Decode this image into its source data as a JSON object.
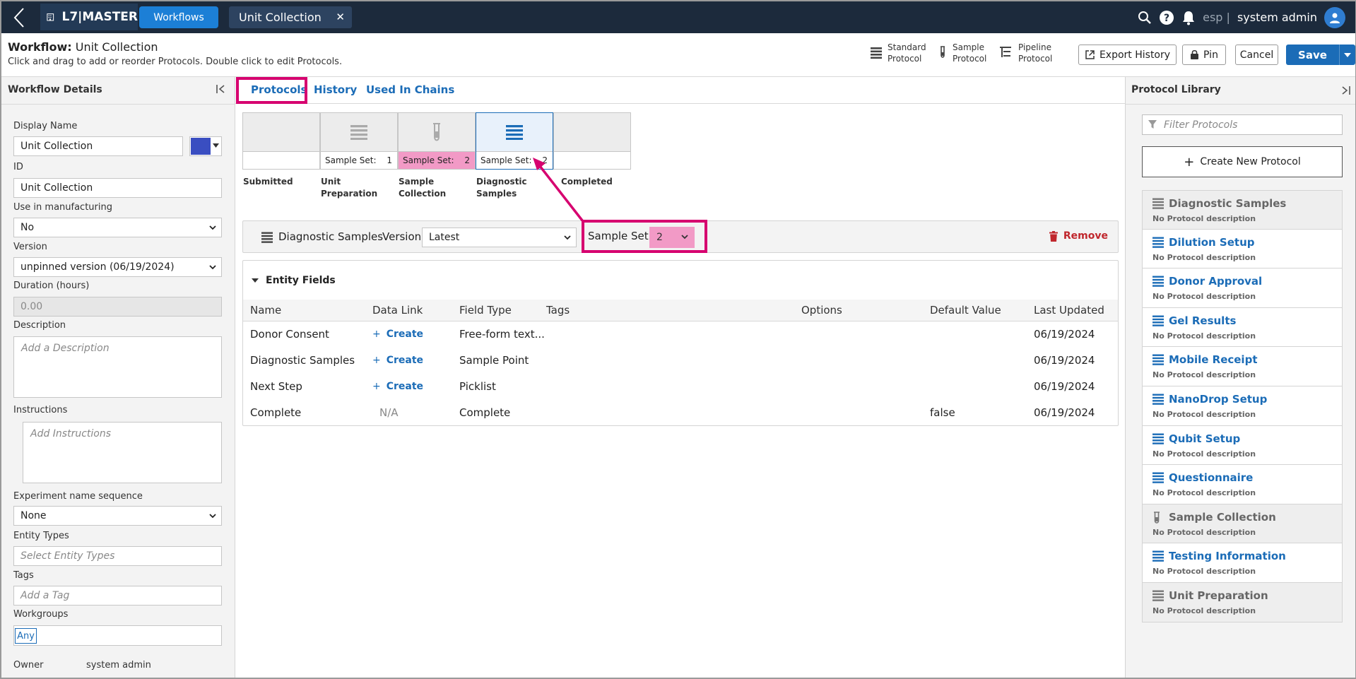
{
  "topbar": {
    "app_name": "L7|MASTER",
    "nav_button": "Workflows",
    "doc_tab": "Unit Collection",
    "lab": "esp |",
    "user": "system admin"
  },
  "header": {
    "title_prefix": "Workflow:",
    "title": "Unit Collection",
    "subtitle": "Click and drag to add or reorder Protocols. Double click to edit Protocols.",
    "legend": [
      {
        "line1": "Standard",
        "line2": "Protocol",
        "icon": "standard-protocol-icon"
      },
      {
        "line1": "Sample",
        "line2": "Protocol",
        "icon": "sample-protocol-icon"
      },
      {
        "line1": "Pipeline",
        "line2": "Protocol",
        "icon": "pipeline-protocol-icon"
      }
    ],
    "export_history": "Export History",
    "pin": "Pin",
    "cancel": "Cancel",
    "save": "Save"
  },
  "left": {
    "panel_title": "Workflow Details",
    "display_name_label": "Display Name",
    "display_name": "Unit Collection",
    "id_label": "ID",
    "id": "Unit Collection",
    "manufacturing_label": "Use in manufacturing",
    "manufacturing": "No",
    "version_label": "Version",
    "version": "unpinned version (06/19/2024)",
    "duration_label": "Duration (hours)",
    "duration": "0.00",
    "description_label": "Description",
    "description_placeholder": "Add a Description",
    "instructions_label": "Instructions",
    "instructions_placeholder": "Add Instructions",
    "exp_seq_label": "Experiment name sequence",
    "exp_seq": "None",
    "entity_types_label": "Entity Types",
    "entity_types_placeholder": "Select Entity Types",
    "tags_label": "Tags",
    "tags_placeholder": "Add a Tag",
    "workgroups_label": "Workgroups",
    "workgroup_chip": "Any",
    "owner_label": "Owner",
    "owner": "system admin",
    "accent": "#3a4ec1"
  },
  "center": {
    "tabs": [
      "Protocols",
      "History",
      "Used In Chains"
    ],
    "steps": [
      {
        "name1": "Submitted",
        "name2": "",
        "sample_label": "",
        "sample_value": "",
        "icon": "none"
      },
      {
        "name1": "Unit Preparation",
        "name2": "",
        "sample_label": "Sample Set:",
        "sample_value": "1",
        "icon": "standard-protocol-icon"
      },
      {
        "name1": "Sample",
        "name2": "Collection",
        "sample_label": "Sample Set:",
        "sample_value": "2",
        "icon": "sample-protocol-icon"
      },
      {
        "name1": "Diagnostic",
        "name2": "Samples",
        "sample_label": "Sample Set:",
        "sample_value": "2",
        "icon": "standard-protocol-icon"
      },
      {
        "name1": "Completed",
        "name2": "",
        "sample_label": "",
        "sample_value": "",
        "icon": "none"
      }
    ],
    "protocol": {
      "name": "Diagnostic Samples",
      "version_label": "Version",
      "version": "Latest",
      "sample_set_label": "Sample Set",
      "sample_set": "2",
      "remove": "Remove"
    },
    "entity_fields": {
      "title": "Entity Fields",
      "columns": [
        "Name",
        "Data Link",
        "Field Type",
        "Tags",
        "Options",
        "Default Value",
        "Last Updated"
      ],
      "create_label": "Create",
      "rows": [
        {
          "name": "Donor Consent",
          "link": "Create",
          "type": "Free-form text...",
          "tags": "",
          "options": "",
          "default": "",
          "updated": "06/19/2024"
        },
        {
          "name": "Diagnostic Samples",
          "link": "Create",
          "type": "Sample Point",
          "tags": "",
          "options": "",
          "default": "",
          "updated": "06/19/2024"
        },
        {
          "name": "Next Step",
          "link": "Create",
          "type": "Picklist",
          "tags": "",
          "options": "",
          "default": "",
          "updated": "06/19/2024"
        },
        {
          "name": "Complete",
          "link": "N/A",
          "type": "Complete",
          "tags": "",
          "options": "",
          "default": "false",
          "updated": "06/19/2024"
        }
      ]
    },
    "highlight_color": "#d6006f",
    "pink": "#f29ac6"
  },
  "right": {
    "panel_title": "Protocol Library",
    "filter_placeholder": "Filter Protocols",
    "create_new": "Create New Protocol",
    "items": [
      {
        "name": "Diagnostic Samples",
        "desc": "No Protocol description",
        "icon": "standard-protocol-icon",
        "active": false
      },
      {
        "name": "Dilution Setup",
        "desc": "No Protocol description",
        "icon": "standard-protocol-icon",
        "active": true
      },
      {
        "name": "Donor Approval",
        "desc": "No Protocol description",
        "icon": "standard-protocol-icon",
        "active": true
      },
      {
        "name": "Gel Results",
        "desc": "No Protocol description",
        "icon": "standard-protocol-icon",
        "active": true
      },
      {
        "name": "Mobile Receipt",
        "desc": "No Protocol description",
        "icon": "standard-protocol-icon",
        "active": true
      },
      {
        "name": "NanoDrop Setup",
        "desc": "No Protocol description",
        "icon": "standard-protocol-icon",
        "active": true
      },
      {
        "name": "Qubit Setup",
        "desc": "No Protocol description",
        "icon": "standard-protocol-icon",
        "active": true
      },
      {
        "name": "Questionnaire",
        "desc": "No Protocol description",
        "icon": "standard-protocol-icon",
        "active": true
      },
      {
        "name": "Sample Collection",
        "desc": "No Protocol description",
        "icon": "sample-protocol-icon",
        "active": false
      },
      {
        "name": "Testing Information",
        "desc": "No Protocol description",
        "icon": "standard-protocol-icon",
        "active": true
      },
      {
        "name": "Unit Preparation",
        "desc": "No Protocol description",
        "icon": "standard-protocol-icon",
        "active": false
      }
    ]
  }
}
